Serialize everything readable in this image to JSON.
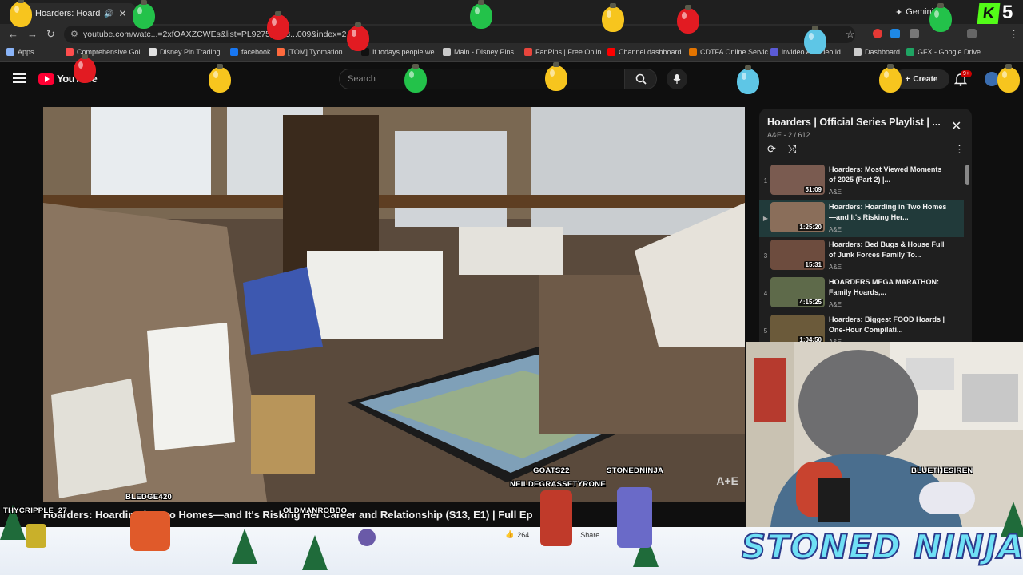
{
  "browser": {
    "tab_title": "Hoarders: Hoarding in",
    "gemini_label": "Gemini",
    "url": "youtube.com/watc...=2xfOAXZCWEs&list=PL9275F4B3...009&index=2",
    "kick_number": "5"
  },
  "bookmarks": [
    {
      "label": "Apps",
      "color": "#8ab4f8"
    },
    {
      "label": "Comprehensive Gol...",
      "color": "#ff4d4d"
    },
    {
      "label": "Disney Pin Trading",
      "color": "#e0e0e0"
    },
    {
      "label": "facebook",
      "color": "#1877f2"
    },
    {
      "label": "[TOM] Tyomation",
      "color": "#ff6a3d"
    },
    {
      "label": "If todays people we...",
      "color": "#111111"
    },
    {
      "label": "Main - Disney Pins...",
      "color": "#c9c9c9"
    },
    {
      "label": "FanPins | Free Onlin...",
      "color": "#e8453c"
    },
    {
      "label": "Channel dashboard...",
      "color": "#ff0000"
    },
    {
      "label": "CDTFA Online Servic...",
      "color": "#e37400"
    },
    {
      "label": "invideo AI Video id...",
      "color": "#5b5bd6"
    },
    {
      "label": "Dashboard",
      "color": "#cccccc"
    },
    {
      "label": "GFX - Google Drive",
      "color": "#1fa463"
    }
  ],
  "youtube": {
    "logo_text": "YouTube",
    "search_placeholder": "Search",
    "create_label": "Create",
    "notification_count": "9+"
  },
  "video": {
    "title": "Hoarders: Hoarding in Two Homes—and It's Risking Her Career and Relationship (S13, E1) | Full Ep",
    "watermark": "A+E",
    "likes": "264",
    "share_label": "Share"
  },
  "playlist": {
    "title": "Hoarders | Official Series Playlist | ...",
    "meta": "A&E - 2 / 612",
    "items": [
      {
        "num": "1",
        "title": "Hoarders: Most Viewed Moments of 2025 (Part 2) |...",
        "channel": "A&E",
        "duration": "51:09",
        "active": false,
        "thumb": "#7a5b50"
      },
      {
        "num": "▶",
        "title": "Hoarders: Hoarding in Two Homes—and It's Risking Her...",
        "channel": "A&E",
        "duration": "1:25:20",
        "active": true,
        "thumb": "#8a6e5a"
      },
      {
        "num": "3",
        "title": "Hoarders: Bed Bugs & House Full of Junk Forces Family To...",
        "channel": "A&E",
        "duration": "15:31",
        "active": false,
        "thumb": "#6d4c3e"
      },
      {
        "num": "4",
        "title": "HOARDERS MEGA MARATHON: Family Hoards,...",
        "channel": "A&E",
        "duration": "4:15:25",
        "active": false,
        "thumb": "#5e6a4a"
      },
      {
        "num": "5",
        "title": "Hoarders: Biggest FOOD Hoards | One-Hour Compilati...",
        "channel": "A&E",
        "duration": "1:04:50",
        "active": false,
        "thumb": "#6b5a3a"
      }
    ]
  },
  "overlay": {
    "chatters": [
      "BLEDGE420",
      "THYCRIPPLE_27",
      "OLDMANROBBO",
      "GOATS22",
      "STONEDNINJA",
      "NEILDEGRASSETYRONE",
      "BLUETHESIREN"
    ],
    "brand": "STONED NINJA"
  },
  "colors": {
    "yt_red": "#ff0033",
    "kick_green": "#53fc18",
    "active_row": "#213a3a"
  }
}
